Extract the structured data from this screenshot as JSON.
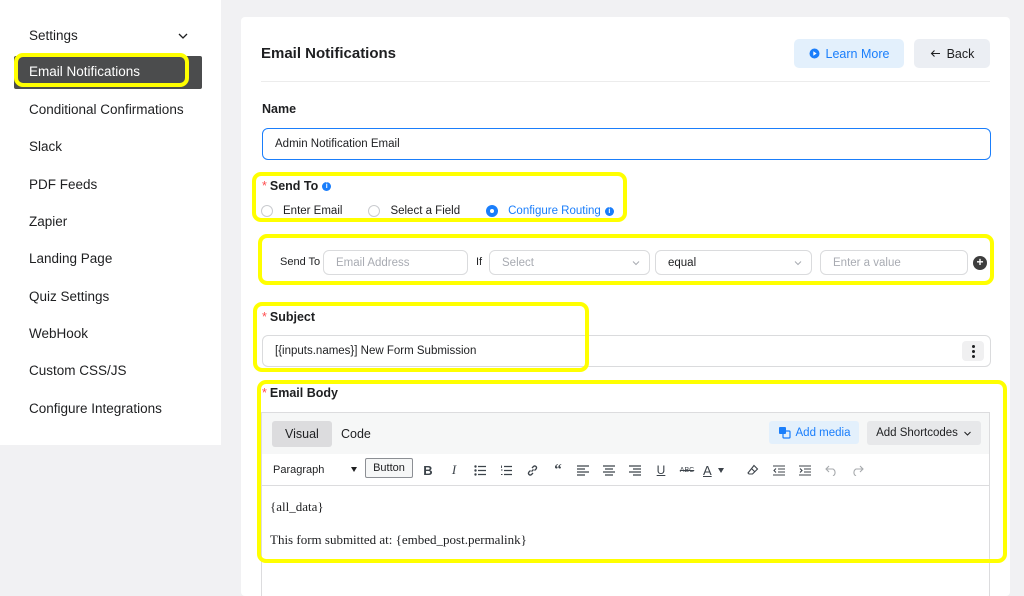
{
  "sidebar": {
    "settings_label": "Settings",
    "active_label": "Email Notifications",
    "items": [
      {
        "label": "Conditional Confirmations"
      },
      {
        "label": "Slack"
      },
      {
        "label": "PDF Feeds"
      },
      {
        "label": "Zapier"
      },
      {
        "label": "Landing Page"
      },
      {
        "label": "Quiz Settings"
      },
      {
        "label": "WebHook"
      },
      {
        "label": "Custom CSS/JS"
      },
      {
        "label": "Configure Integrations"
      }
    ]
  },
  "header": {
    "title": "Email Notifications",
    "learn_more": "Learn More",
    "back": "Back"
  },
  "form": {
    "name_label": "Name",
    "name_value": "Admin Notification Email",
    "required_mark": "*",
    "send_to_label": "Send To",
    "send_to_options": {
      "enter_email": "Enter Email",
      "select_field": "Select a Field",
      "configure_routing": "Configure Routing"
    },
    "selected_option": "Configure Routing",
    "routing": {
      "send_to_label": "Send To",
      "email_placeholder": "Email Address",
      "if_label": "If",
      "field_placeholder": "Select",
      "operator_value": "equal",
      "value_placeholder": "Enter a value"
    },
    "subject_label": "Subject",
    "subject_value": "[{inputs.names}] New Form Submission",
    "body_label": "Email Body"
  },
  "editor": {
    "tab_visual": "Visual",
    "tab_code": "Code",
    "add_media": "Add media",
    "add_shortcodes": "Add Shortcodes",
    "format_value": "Paragraph",
    "button_label": "Button",
    "content_line1": "{all_data}",
    "content_line2": "This form submitted at: {embed_post.permalink}"
  },
  "colors": {
    "accent": "#1a7efb",
    "highlight": "#ffff00",
    "sidebar_active": "#4b4c4d"
  }
}
